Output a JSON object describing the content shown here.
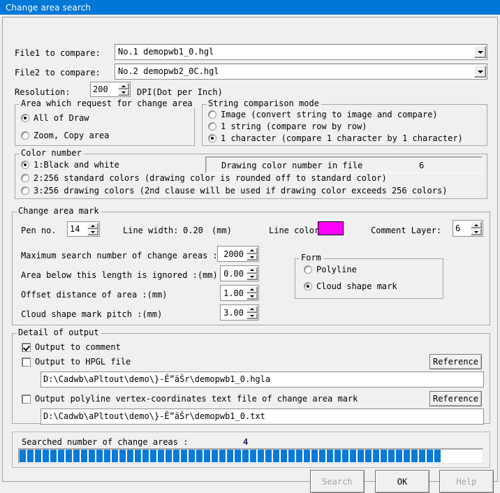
{
  "window": {
    "title": "Change area search",
    "titlebar_color": "#0078d7"
  },
  "files": {
    "file1_label": "File1 to compare:",
    "file1_value": "No.1 demopwb1_0.hgl",
    "file2_label": "File2 to compare:",
    "file2_value": "No.2 demopwb2_0C.hgl",
    "resolution_label": "Resolution:",
    "resolution_value": "200",
    "resolution_unit": "DPI(Dot per Inch)"
  },
  "area_request": {
    "legend": "Area which request for change area",
    "options": [
      {
        "label": "All of Draw",
        "selected": true
      },
      {
        "label": "Zoom, Copy area",
        "selected": false
      }
    ]
  },
  "string_mode": {
    "legend": "String comparison mode",
    "options": [
      {
        "label": "Image (convert string to image and compare)",
        "selected": false
      },
      {
        "label": "1 string (compare row by row)",
        "selected": false
      },
      {
        "label": "1 character (compare 1 character by 1 character)",
        "selected": true
      }
    ]
  },
  "color_number": {
    "legend": "Color number",
    "options": [
      {
        "label": "1:Black and white",
        "selected": true
      },
      {
        "label": "2:256 standard colors (drawing color is rounded off to standard color)",
        "selected": false
      },
      {
        "label": "3:256 drawing colors (2nd clause will be used if drawing color exceeds 256 colors)",
        "selected": false
      }
    ],
    "info_label": "Drawing color number in file",
    "info_value": "6"
  },
  "change_area_mark": {
    "legend": "Change area mark",
    "pen_no_label": "Pen no.",
    "pen_no_value": "14",
    "line_width_label": "Line width:",
    "line_width_value": "0.20",
    "line_width_unit": "(mm)",
    "line_color_label": "Line color:",
    "line_color_value": "#ff00ff",
    "comment_layer_label": "Comment Layer:",
    "comment_layer_value": "6",
    "max_search_label": "Maximum search number of change areas :",
    "max_search_value": "2000",
    "ignore_length_label": "Area below this length is ignored :(mm)",
    "ignore_length_value": "0.00",
    "offset_label": "Offset distance of area :(mm)",
    "offset_value": "1.00",
    "pitch_label": "Cloud shape mark pitch :(mm)",
    "pitch_value": "3.00",
    "form": {
      "legend": "Form",
      "options": [
        {
          "label": "Polyline",
          "selected": false
        },
        {
          "label": "Cloud shape mark",
          "selected": true
        }
      ]
    }
  },
  "detail_output": {
    "legend": "Detail of output",
    "output_to_comment": {
      "label": "Output to comment",
      "checked": true
    },
    "output_hpgl": {
      "label": "Output to HPGL file",
      "checked": false
    },
    "hpgl_path": "D:\\Cadwb\\aPltout\\demo\\}-Ê”äŠr\\demopwb1_0.hgla",
    "hpgl_reference_button": "Reference",
    "output_polyline": {
      "label": "Output polyline vertex-coordinates text file of change area mark",
      "checked": false
    },
    "polyline_path": "D:\\Cadwb\\aPltout\\demo\\}-Ê”äŠr\\demopwb1_0.txt",
    "polyline_reference_button": "Reference"
  },
  "progress": {
    "label": "Searched number of change areas :",
    "count": "4",
    "bar_color": "#0a7ad8",
    "segments": 55
  },
  "buttons": {
    "search": {
      "label": "Search",
      "enabled": false
    },
    "ok": {
      "label": "OK",
      "enabled": true
    },
    "help": {
      "label": "Help",
      "enabled": false
    }
  }
}
